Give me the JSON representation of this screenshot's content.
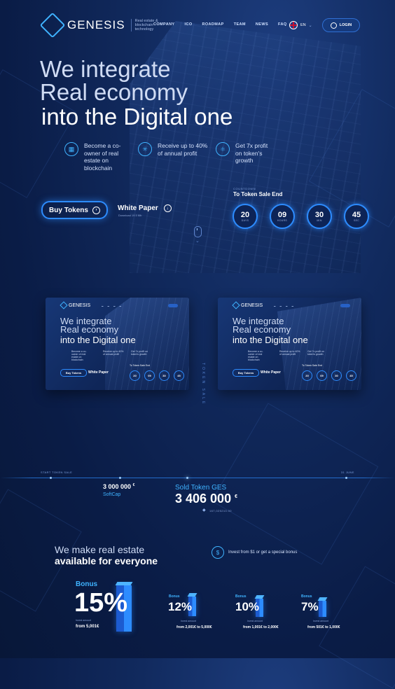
{
  "brand": {
    "name": "GENESIS",
    "tagline": "Real estate & blockchain technology"
  },
  "nav": {
    "items": [
      "COMPANY",
      "ICO",
      "ROADMAP",
      "TEAM",
      "NEWS",
      "FAQ"
    ]
  },
  "lang": {
    "code": "EN"
  },
  "login": {
    "label": "LOGIN"
  },
  "hero": {
    "line1": "We integrate",
    "line2": "Real economy",
    "line3": "into the Digital one",
    "features": [
      {
        "icon": "building-icon",
        "text": "Become a co-owner of real estate on blockchain"
      },
      {
        "icon": "network-icon",
        "text": "Receive up to 40% of annual profit"
      },
      {
        "icon": "atom-icon",
        "text": "Get 7x profit on token's growth"
      }
    ],
    "buy_label": "Buy Tokens",
    "white_paper": "White Paper",
    "white_paper_sub": "Download 19.5 Mb"
  },
  "timer": {
    "label": "COUNTDOWN",
    "title": "To Token Sale End",
    "units": [
      {
        "value": "20",
        "unit": "DAYS"
      },
      {
        "value": "09",
        "unit": "HOURS"
      },
      {
        "value": "30",
        "unit": "MIN"
      },
      {
        "value": "45",
        "unit": "SEC"
      }
    ]
  },
  "preview": {
    "logo": "GENESIS",
    "line1": "We integrate",
    "line2": "Real economy",
    "line3": "into the Digital one",
    "f1": "Become a co-owner of real estate on blockchain",
    "f2": "Receive up to 40% of annual profit",
    "f3": "Get 7x profit on token's growth",
    "buy": "Buy Tokens",
    "wp": "White Paper",
    "timer_title": "To Token Sale End",
    "nums": [
      "20",
      "09",
      "30",
      "45"
    ]
  },
  "token_sale": {
    "vertical": "TOKEN SALE",
    "start_label": "START TOKEN SALE",
    "end_label": "31 JUNE",
    "softcap_value": "3 000 000",
    "softcap_unit": "€",
    "softcap_label": "SoftCap",
    "sold_label": "Sold Token GES",
    "sold_value": "3 406 000",
    "sold_unit": "€",
    "eth_value": "167,025210.00"
  },
  "bonus": {
    "title1": "We make real estate",
    "title2": "available for everyone",
    "invest_text": "Invest from $1 or get a special bonus",
    "tiers": [
      {
        "label": "Bonus",
        "pct": "15%",
        "sub": "Invest amount",
        "range": "from 5,001€"
      },
      {
        "label": "Bonus",
        "pct": "12%",
        "sub": "Invest amount",
        "range": "from 2,001€ to 5,000€"
      },
      {
        "label": "Bonus",
        "pct": "10%",
        "sub": "Invest amount",
        "range": "from 1,001€ to 2,000€"
      },
      {
        "label": "Bonus",
        "pct": "7%",
        "sub": "Invest amount",
        "range": "from 501€ to 1,000€"
      }
    ]
  },
  "colors": {
    "accent": "#2d8cff",
    "bg": "#0a1c46",
    "highlight": "#3fb3ff"
  }
}
